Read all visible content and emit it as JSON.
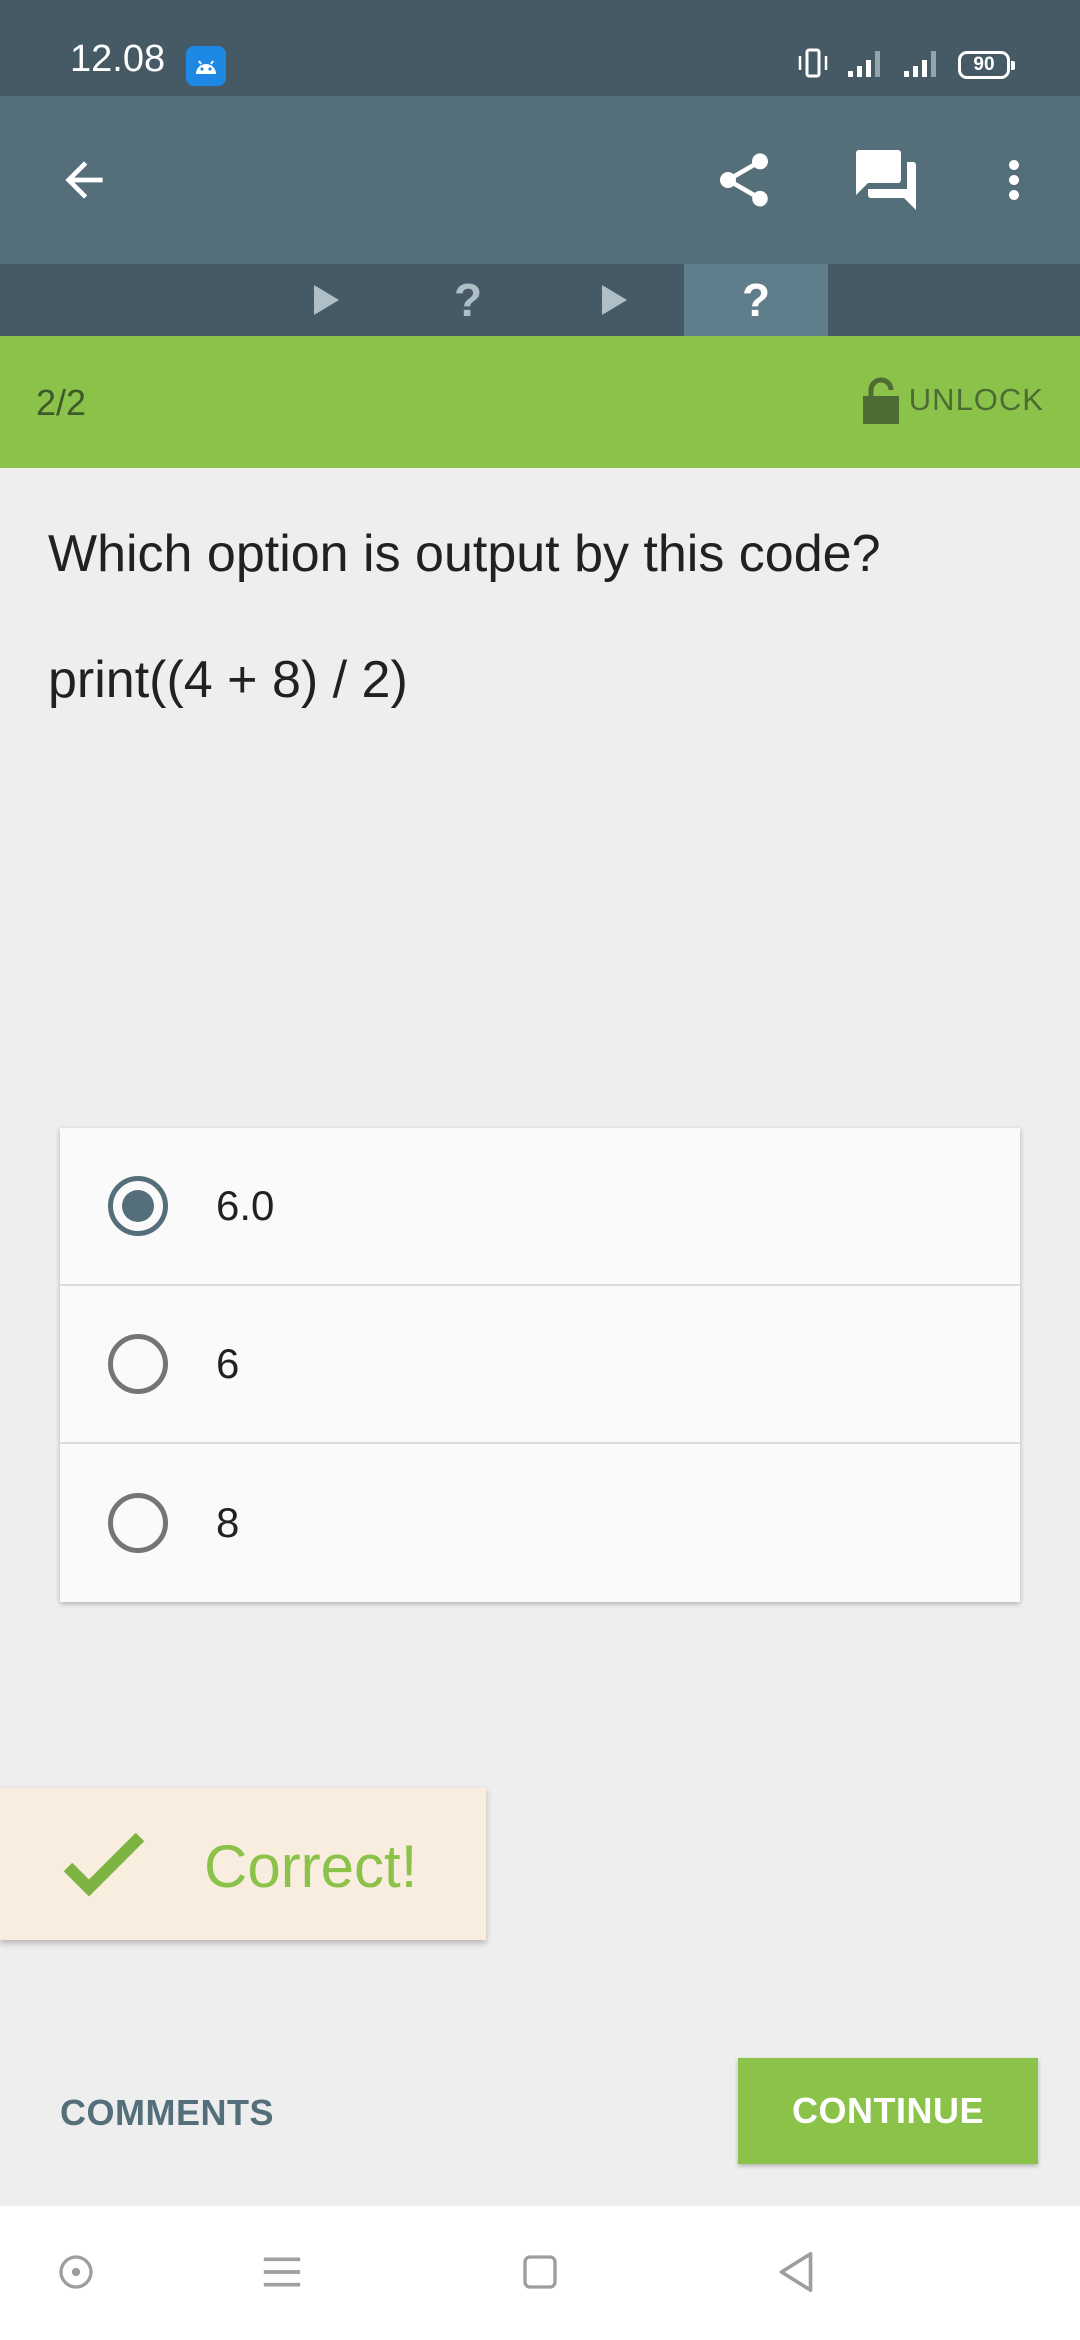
{
  "status_bar": {
    "time": "12.08",
    "battery": "90",
    "icons": [
      "android-app-icon",
      "vibrate-icon",
      "signal-icon",
      "signal-icon",
      "battery-icon"
    ]
  },
  "toolbar": {
    "icons": [
      "back-arrow-icon",
      "share-icon",
      "comments-icon",
      "more-vert-icon"
    ]
  },
  "tabs": [
    {
      "icon": "play-icon",
      "active": false
    },
    {
      "label": "?",
      "active": false
    },
    {
      "icon": "play-icon",
      "active": false
    },
    {
      "label": "?",
      "active": true
    }
  ],
  "progress": {
    "count": "2/2",
    "unlock_label": "UNLOCK"
  },
  "quiz": {
    "question": "Which option is output by this code?",
    "code": "print((4 + 8) / 2)",
    "options": [
      {
        "label": "6.0",
        "selected": true
      },
      {
        "label": "6",
        "selected": false
      },
      {
        "label": "8",
        "selected": false
      }
    ]
  },
  "feedback": {
    "message": "Correct!"
  },
  "actions": {
    "comments_label": "COMMENTS",
    "continue_label": "CONTINUE"
  },
  "colors": {
    "status_bar": "#455a64",
    "toolbar": "#546e7a",
    "accent_green": "#8bc34a",
    "toast_bg": "#f9ede0"
  }
}
